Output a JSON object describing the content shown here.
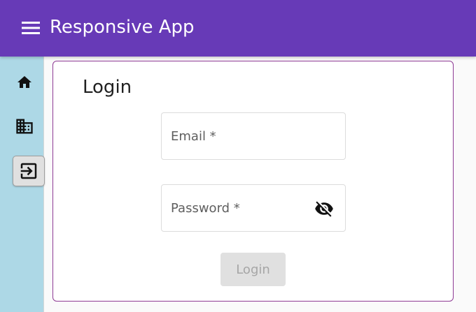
{
  "app_bar": {
    "title": "Responsive App",
    "menu_icon": "menu-icon",
    "background": "#673ab7"
  },
  "sidebar": {
    "background": "#add8e6",
    "items": [
      {
        "icon": "home-icon",
        "active": false
      },
      {
        "icon": "business-icon",
        "active": false
      },
      {
        "icon": "logout-icon",
        "active": true
      }
    ]
  },
  "login": {
    "heading": "Login",
    "email_label": "Email *",
    "email_value": "",
    "password_label": "Password *",
    "password_value": "",
    "password_toggle_icon": "visibility-off-icon",
    "submit_label": "Login",
    "submit_disabled": true,
    "border_color": "#8e3a94"
  }
}
